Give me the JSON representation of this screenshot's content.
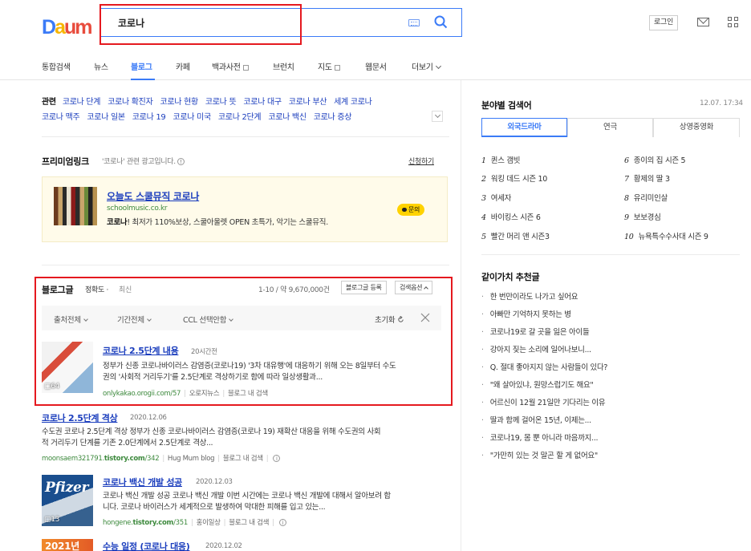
{
  "header": {
    "logo": {
      "p1": "D",
      "p2": "a",
      "p3": "u",
      "p4": "m"
    },
    "search_value": "코로나",
    "login": "로그인"
  },
  "nav": {
    "items": [
      "통합검색",
      "뉴스",
      "블로그",
      "카페",
      "백과사전",
      "브런치",
      "지도",
      "웹문서",
      "더보기"
    ],
    "active": "블로그"
  },
  "related": {
    "label": "관련",
    "keywords": [
      "코로나 단계",
      "코로나 확진자",
      "코로나 현황",
      "코로나 뜻",
      "코로나 대구",
      "코로나 부산",
      "세계 코로나",
      "코로나 맥주",
      "코로나 일본",
      "코로나 19",
      "코로나 미국",
      "코로나 2단계",
      "코로나 백신",
      "코로나 증상"
    ]
  },
  "premium": {
    "title": "프리미엄링크",
    "note": "'코로나' 관련 광고입니다.",
    "apply": "신청하기",
    "ad": {
      "title": "오늘도 스쿨뮤직 코로나",
      "url": "schoolmusic.co.kr",
      "desc_hl": "코로나",
      "desc_rest": "! 최저가 110%보상, 스쿨아울렛 OPEN 초특가, 악기는 스쿨뮤직.",
      "inquiry": "문의"
    }
  },
  "blog": {
    "title": "블로그글",
    "sort_accuracy": "정확도",
    "sort_dot": "·",
    "sort_latest": "최신",
    "count": "1-10 / 약 9,670,000건",
    "register_btn": "블로그글 등록",
    "options_btn": "검색옵션",
    "filters": [
      "출처전체",
      "기간전체",
      "CCL 선택안함"
    ],
    "reset": "초기화",
    "results": [
      {
        "title_hl": "코로나",
        "title_rest": " 2.5단계 내용",
        "date": "20시간전",
        "desc1": "정부가 신종 코로나바이러스 감염증(코로나19) '3차 대유행'에 대응하기 위해 오는 8일부터 수도",
        "desc2": "권의 '사회적 거리두기'를 2.5단계로 격상하기로 함에 따라 일상생활과...",
        "url": "onlykakao.orogii.com/57",
        "blog": "오로지뉴스",
        "in_blog": "블로그 내 검색",
        "thumb_count": "64"
      },
      {
        "title_hl": "코로나",
        "title_rest": " 2.5단계 격상",
        "date": "2020.12.06",
        "desc1": "수도권 코로나 2.5단계 격상 정부가 신종 코로나바이러스 감염증(코로나 19) 재확산 대응을 위해 수도권의 사회",
        "desc2": "적 거리두기 단계를 기존 2.0단계에서 2.5단계로 격상...",
        "url_pre": "moonsaem321791.",
        "url_bold": "tistory.com",
        "url_post": "/342",
        "blog": "Hug Mum blog",
        "in_blog": "블로그 내 검색"
      },
      {
        "title_hl": "코로나",
        "title_rest": " 백신 개발 성공",
        "date": "2020.12.03",
        "desc1": "코로나 백신 개발 성공 코로나 백신 개발 이번 시간에는 코로나 백신 개발에 대해서 알아보려 합",
        "desc2": "니다. 코로나 바이러스가 세계적으로 발생하여 막대한 피해를 입고 있는...",
        "url_pre": "hongene.",
        "url_bold": "tistory.com",
        "url_post": "/351",
        "blog": "홍이일상",
        "in_blog": "블로그 내 검색",
        "thumb_count": "13",
        "thumb_text": "Pfizer"
      },
      {
        "title_pre": "수능 일정 (",
        "title_hl": "코로나",
        "title_rest": " 대응)",
        "date": "2020.12.02",
        "thumb_text": "2021년"
      }
    ]
  },
  "trending": {
    "title": "분야별 검색어",
    "time": "12.07. 17:34",
    "tabs": [
      "외국드라마",
      "연극",
      "상영중영화"
    ],
    "ranks": [
      {
        "n": "1",
        "t": "퀸스 갬빗"
      },
      {
        "n": "2",
        "t": "워킹 데드 시즌 10"
      },
      {
        "n": "3",
        "t": "여세자"
      },
      {
        "n": "4",
        "t": "바이킹스 시즌 6"
      },
      {
        "n": "5",
        "t": "빨간 머리 앤 시즌3"
      },
      {
        "n": "6",
        "t": "종이의 집 시즌 5"
      },
      {
        "n": "7",
        "t": "황제의 딸 3"
      },
      {
        "n": "8",
        "t": "유리미인살"
      },
      {
        "n": "9",
        "t": "보보경심"
      },
      {
        "n": "10",
        "t": "뉴욕특수수사대 시즌 9"
      }
    ]
  },
  "recommend": {
    "title": "같이가치 추천글",
    "items": [
      "한 번만이라도 나가고 싶어요",
      "아빠만 기억하지 못하는 병",
      "코로나19로 갈 곳을 잃은 아이들",
      "강아지 짖는 소리에 일어나보니...",
      "Q. 절대 좋아지지 않는 사람들이 있다?",
      "\"왜 살아있냐, 원망스럽기도 해요\"",
      "어르신이 12월 21일만 기다리는 이유",
      "딸과 함께 걸어온 15년, 이제는...",
      "코로나19, 몸 뿐 아니라 마음까지...",
      "\"가만히 있는 것 말곤 할 게 없어요\""
    ]
  },
  "colors": {
    "accent": "#3b7bf7",
    "highlight_box": "#e5191f",
    "link": "#1a3dbd",
    "url": "#3e8a3e"
  }
}
